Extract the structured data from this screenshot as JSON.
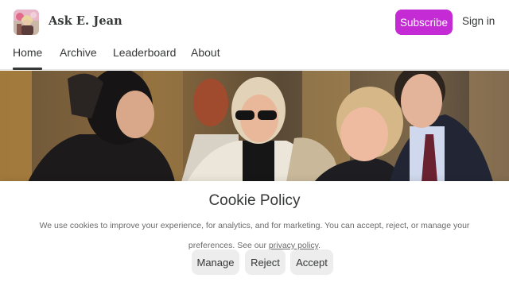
{
  "site": {
    "title": "Ask E. Jean"
  },
  "header": {
    "subscribe_label": "Subscribe",
    "signin_label": "Sign in",
    "accent_color": "#c42bd4"
  },
  "nav": {
    "items": [
      {
        "label": "Home",
        "active": true
      },
      {
        "label": "Archive"
      },
      {
        "label": "Leaderboard"
      },
      {
        "label": "About"
      }
    ]
  },
  "cookie": {
    "title": "Cookie Policy",
    "text_before": "We use cookies to improve your experience, for analytics, and for marketing. You can accept, reject, or manage your preferences. See our ",
    "link_label": "privacy policy",
    "text_after": ".",
    "buttons": {
      "manage": "Manage",
      "reject": "Reject",
      "accept": "Accept"
    }
  }
}
